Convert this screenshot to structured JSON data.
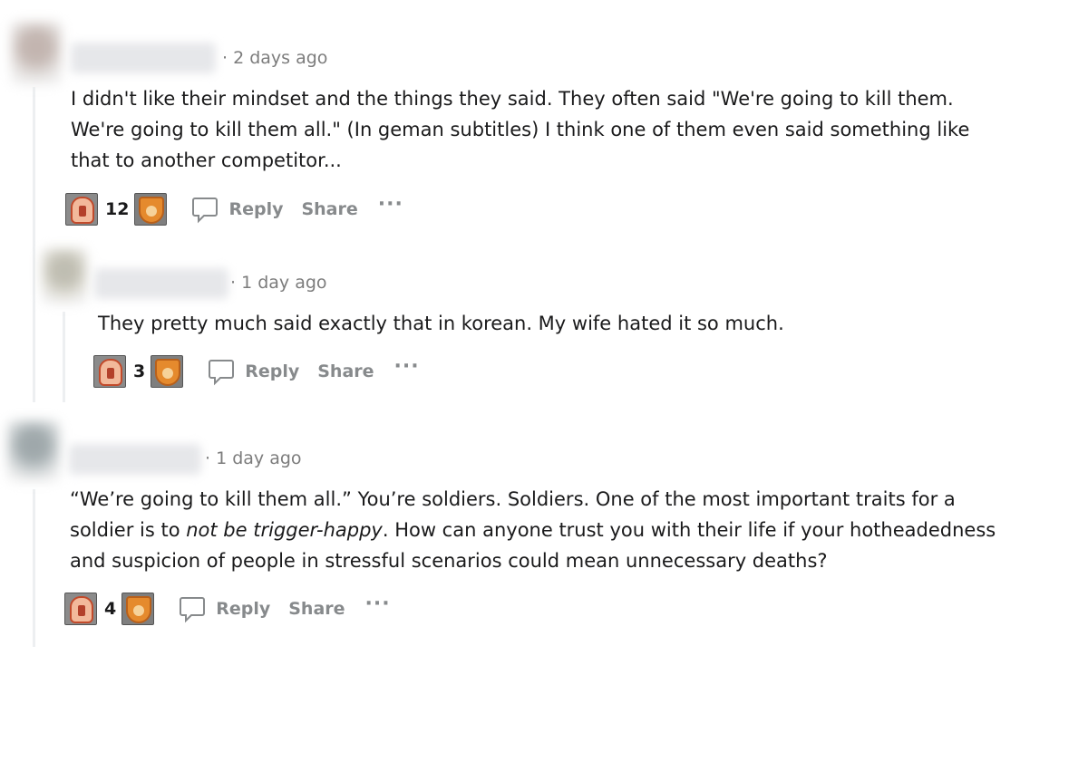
{
  "comments": [
    {
      "time": "· 2 days ago",
      "body": [
        "I didn't like their mindset and the things they said. They often said \"We're going to kill them.",
        "We're going to kill them all.\" (In geman subtitles) I think one of them even said something like",
        "that to another competitor..."
      ],
      "votes": "12",
      "reply": "Reply",
      "share": "Share"
    },
    {
      "time": "· 1 day ago",
      "body": [
        "They pretty much said exactly that in korean. My wife hated it so much."
      ],
      "votes": "3",
      "reply": "Reply",
      "share": "Share"
    },
    {
      "time": "· 1 day ago",
      "body_line1": "“We’re going to kill them all.” You’re soldiers. Soldiers. One of the most important traits for a",
      "body_line2_pre": "soldier is to ",
      "body_line2_em": "not be trigger-happy",
      "body_line2_post": ". How can anyone trust you with their life if your hotheadedness",
      "body_line3": "and suspicion of people in stressful scenarios could mean unnecessary deaths?",
      "votes": "4",
      "reply": "Reply",
      "share": "Share"
    }
  ],
  "colors": {
    "meta": "#7c7c7c",
    "action": "#878a8c",
    "thread": "#edeff1"
  },
  "icons": [
    "award-badge-icon",
    "award-shield-icon",
    "comment-bubble-icon",
    "more-options-icon"
  ]
}
